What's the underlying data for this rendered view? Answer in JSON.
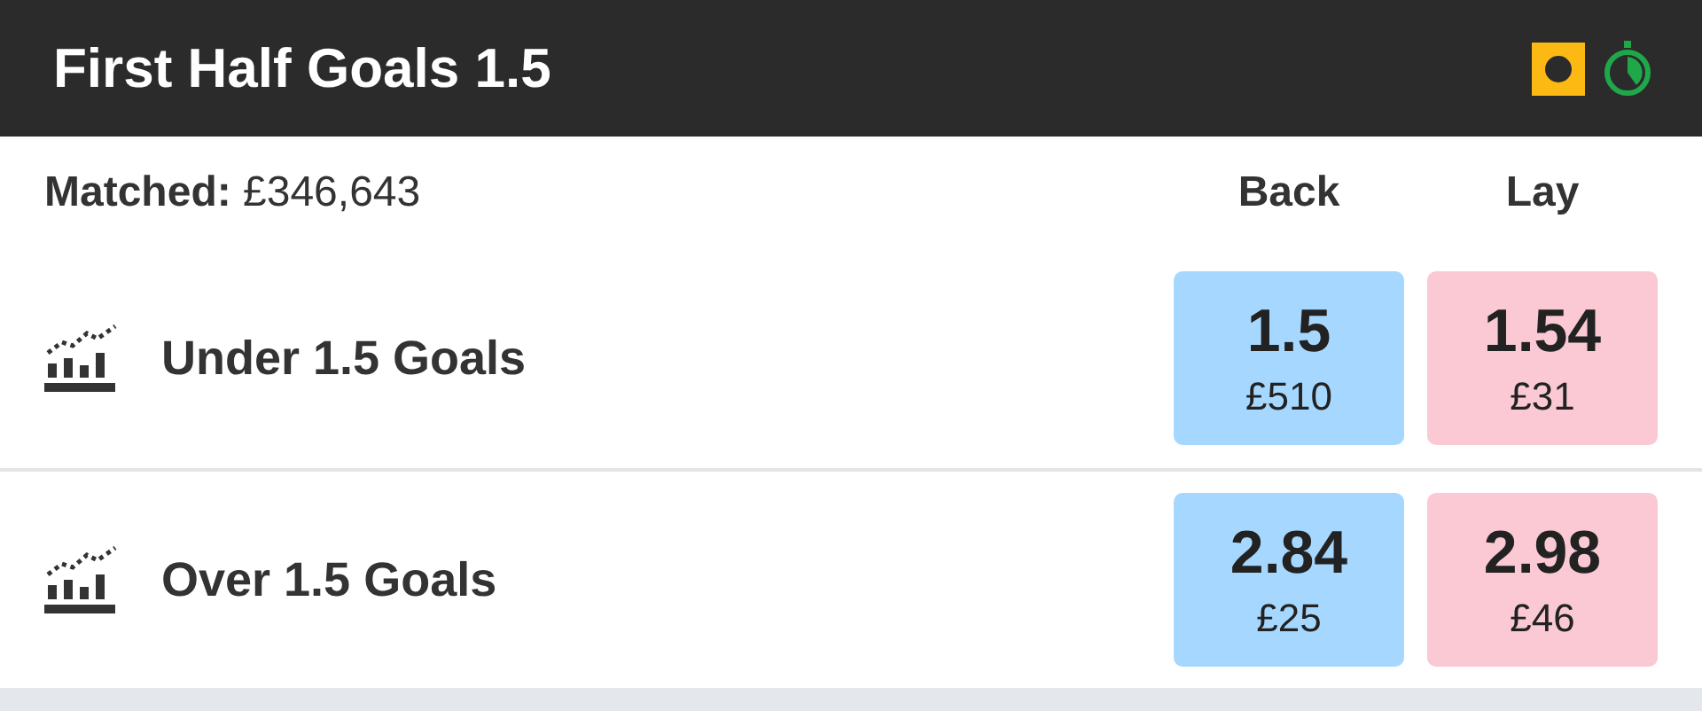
{
  "header": {
    "title": "First Half Goals 1.5"
  },
  "summary": {
    "matched_label": "Matched:",
    "matched_value": "£346,643",
    "columns": [
      "Back",
      "Lay"
    ]
  },
  "runners": [
    {
      "name": "Under 1.5 Goals",
      "back": {
        "odds": "1.5",
        "amount": "£510"
      },
      "lay": {
        "odds": "1.54",
        "amount": "£31"
      }
    },
    {
      "name": "Over 1.5 Goals",
      "back": {
        "odds": "2.84",
        "amount": "£25"
      },
      "lay": {
        "odds": "2.98",
        "amount": "£46"
      }
    }
  ]
}
